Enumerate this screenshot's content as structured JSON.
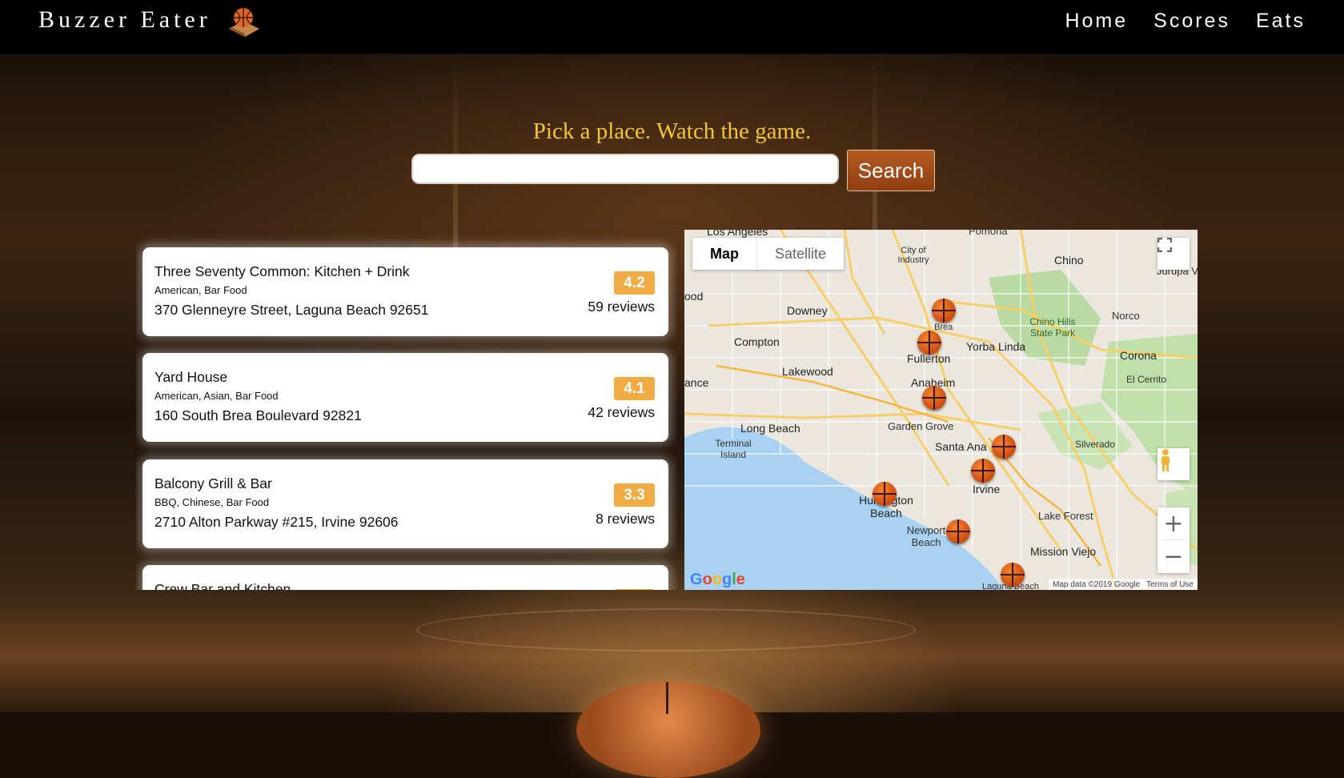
{
  "nav": {
    "brand": "Buzzer Eater",
    "links": [
      "Home",
      "Scores",
      "Eats"
    ]
  },
  "hero": {
    "tagline": "Pick a place. Watch the game.",
    "search_value": "",
    "search_button": "Search"
  },
  "results": [
    {
      "name": "Three Seventy Common: Kitchen + Drink",
      "cuisine": "American, Bar Food",
      "address": "370 Glenneyre Street, Laguna Beach 92651",
      "rating": "4.2",
      "reviews": "59 reviews"
    },
    {
      "name": "Yard House",
      "cuisine": "American, Asian, Bar Food",
      "address": "160 South Brea Boulevard 92821",
      "rating": "4.1",
      "reviews": "42 reviews"
    },
    {
      "name": "Balcony Grill & Bar",
      "cuisine": "BBQ, Chinese, Bar Food",
      "address": "2710 Alton Parkway #215, Irvine 92606",
      "rating": "3.3",
      "reviews": "8 reviews"
    },
    {
      "name": "Crew Bar and Kitchen",
      "cuisine": "",
      "address": "",
      "rating": "",
      "reviews": ""
    }
  ],
  "map": {
    "type_map": "Map",
    "type_satellite": "Satellite",
    "fullscreen_icon": "fullscreen-icon",
    "pegman_icon": "pegman-icon",
    "zoom_in": "+",
    "zoom_out": "−",
    "logo": "Google",
    "attribution": "Map data ©2019 Google",
    "terms": "Terms of Use",
    "labels": {
      "los_angeles": "Los Angeles",
      "pomona": "Pomona",
      "city_of_industry": "City of Industry",
      "chino": "Chino",
      "jurupa": "Jurupa V",
      "wood": "ood",
      "downey": "Downey",
      "compton": "Compton",
      "brea": "Brea",
      "yorba_linda": "Yorba Linda",
      "chino_hills": "Chino Hills State Park",
      "norco": "Norco",
      "corona": "Corona",
      "fullerton": "Fullerton",
      "lakewood": "Lakewood",
      "anaheim": "Anaheim",
      "el_cerrito": "El Cerrito",
      "lance": "ance",
      "long_beach": "Long Beach",
      "garden_grove": "Garden Grove",
      "terminal_island": "Terminal Island",
      "santa_ana": "Santa Ana",
      "silverado": "Silverado",
      "irvine": "Irvine",
      "huntington_beach": "Huntington Beach",
      "lake_forest": "Lake Forest",
      "newport_beach": "Newport Beach",
      "mission_viejo": "Mission Viejo",
      "laguna_beach": "Laguna Beach"
    },
    "pin_count": 8
  },
  "colors": {
    "tagline": "#f2c531",
    "search_button": "#a24c18",
    "rating_badge": "#f0ab45",
    "nav_bg": "#000000"
  }
}
